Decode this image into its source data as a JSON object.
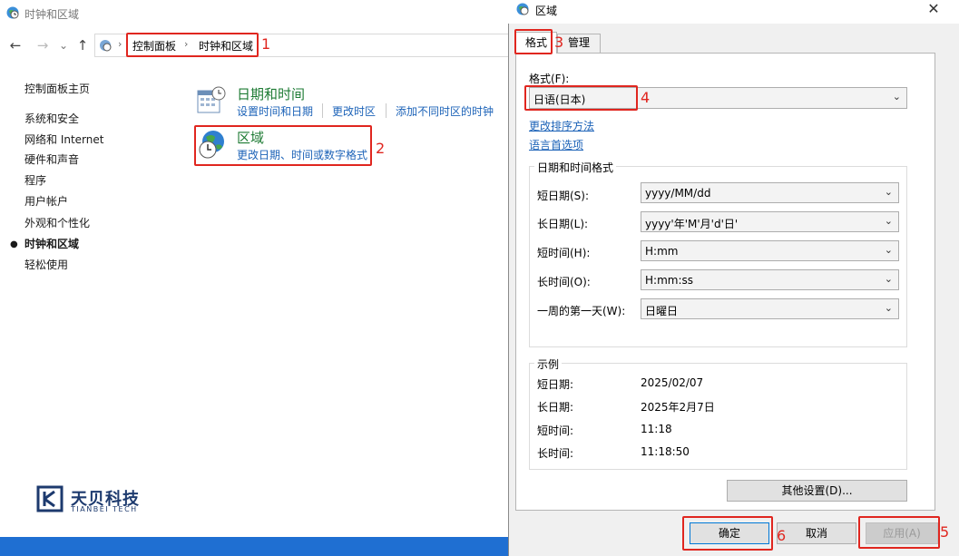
{
  "control_panel": {
    "title": "时钟和区域",
    "nav": {
      "back": "←",
      "forward": "→",
      "dropdown": "⌄",
      "up": "↑"
    },
    "address": {
      "sep0": "›",
      "crumb1": "控制面板",
      "sep1": "›",
      "crumb2": "时钟和区域"
    },
    "sidebar": {
      "home": "控制面板主页",
      "items": [
        "系统和安全",
        "网络和 Internet",
        "硬件和声音",
        "程序",
        "用户帐户",
        "外观和个性化",
        "时钟和区域",
        "轻松使用"
      ],
      "bullet": "●"
    },
    "categories": [
      {
        "title": "日期和时间",
        "links": [
          "设置时间和日期",
          "更改时区",
          "添加不同时区的时钟"
        ]
      },
      {
        "title": "区域",
        "links": [
          "更改日期、时间或数字格式"
        ]
      }
    ],
    "logo": {
      "cn": "天贝科技",
      "en": "TIANBEI TECH"
    }
  },
  "annotations": {
    "n1": "1",
    "n2": "2",
    "n3": "3",
    "n4": "4",
    "n5": "5",
    "n6": "6"
  },
  "dialog": {
    "title": "区域",
    "close": "✕",
    "tabs": {
      "format": "格式",
      "manage": "管理"
    },
    "format_label": "格式(F):",
    "format_value": "日语(日本)",
    "sort_link": "更改排序方法",
    "lang_link": "语言首选项",
    "group_datetime": {
      "title": "日期和时间格式",
      "rows": [
        {
          "label": "短日期(S):",
          "value": "yyyy/MM/dd"
        },
        {
          "label": "长日期(L):",
          "value": "yyyy'年'M'月'd'日'"
        },
        {
          "label": "短时间(H):",
          "value": "H:mm"
        },
        {
          "label": "长时间(O):",
          "value": "H:mm:ss"
        },
        {
          "label": "一周的第一天(W):",
          "value": "日曜日"
        }
      ]
    },
    "group_example": {
      "title": "示例",
      "rows": [
        {
          "label": "短日期:",
          "value": "2025/02/07"
        },
        {
          "label": "长日期:",
          "value": "2025年2月7日"
        },
        {
          "label": "短时间:",
          "value": "11:18"
        },
        {
          "label": "长时间:",
          "value": "11:18:50"
        }
      ]
    },
    "buttons": {
      "other": "其他设置(D)...",
      "ok": "确定",
      "cancel": "取消",
      "apply": "应用(A)"
    },
    "arrow": "⌄"
  },
  "colors": {
    "annotation": "#e0261f",
    "link": "#1d63b8",
    "category": "#1e7b34",
    "taskbar": "#1f6fd2"
  }
}
